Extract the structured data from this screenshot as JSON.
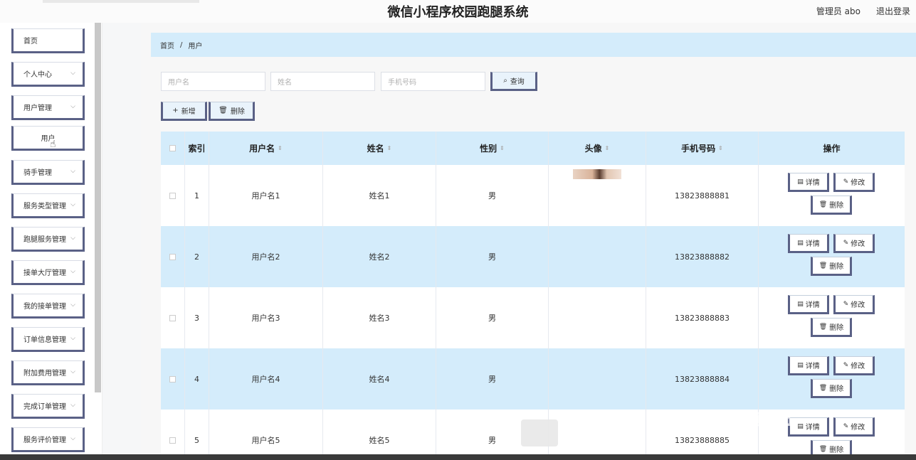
{
  "header": {
    "title": "微信小程序校园跑腿系统",
    "user_label": "管理员 abo",
    "logout_label": "退出登录"
  },
  "sidebar": {
    "items": [
      {
        "label": "首页",
        "has_chevron": false
      },
      {
        "label": "个人中心",
        "has_chevron": true
      },
      {
        "label": "用户管理",
        "has_chevron": true
      },
      {
        "label": "用户",
        "has_chevron": false,
        "sub": true
      },
      {
        "label": "骑手管理",
        "has_chevron": true
      },
      {
        "label": "服务类型管理",
        "has_chevron": true
      },
      {
        "label": "跑腿服务管理",
        "has_chevron": true
      },
      {
        "label": "接单大厅管理",
        "has_chevron": true
      },
      {
        "label": "我的接单管理",
        "has_chevron": true
      },
      {
        "label": "订单信息管理",
        "has_chevron": true
      },
      {
        "label": "附加费用管理",
        "has_chevron": true
      },
      {
        "label": "完成订单管理",
        "has_chevron": true
      },
      {
        "label": "服务评价管理",
        "has_chevron": true
      }
    ]
  },
  "breadcrumb": {
    "home": "首页",
    "separator": "/",
    "current": "用户"
  },
  "search": {
    "username_placeholder": "用户名",
    "name_placeholder": "姓名",
    "phone_placeholder": "手机号码",
    "query_label": "查询"
  },
  "actions": {
    "add_label": "新增",
    "delete_label": "删除"
  },
  "table": {
    "headers": {
      "index": "索引",
      "username": "用户名",
      "name": "姓名",
      "gender": "性别",
      "avatar": "头像",
      "phone": "手机号码",
      "ops": "操作"
    },
    "rows": [
      {
        "index": "1",
        "username": "用户名1",
        "name": "姓名1",
        "gender": "男",
        "phone": "13823888881",
        "has_avatar": true
      },
      {
        "index": "2",
        "username": "用户名2",
        "name": "姓名2",
        "gender": "男",
        "phone": "13823888882",
        "has_avatar": false
      },
      {
        "index": "3",
        "username": "用户名3",
        "name": "姓名3",
        "gender": "男",
        "phone": "13823888883",
        "has_avatar": false
      },
      {
        "index": "4",
        "username": "用户名4",
        "name": "姓名4",
        "gender": "男",
        "phone": "13823888884",
        "has_avatar": false
      },
      {
        "index": "5",
        "username": "用户名5",
        "name": "姓名5",
        "gender": "男",
        "phone": "13823888885",
        "has_avatar": false
      }
    ],
    "op_labels": {
      "detail": "详情",
      "edit": "修改",
      "delete": "删除"
    }
  },
  "colors": {
    "accent": "#5a6186",
    "header_bg": "#d4ecfb",
    "row_alt": "#d4ecfb"
  }
}
